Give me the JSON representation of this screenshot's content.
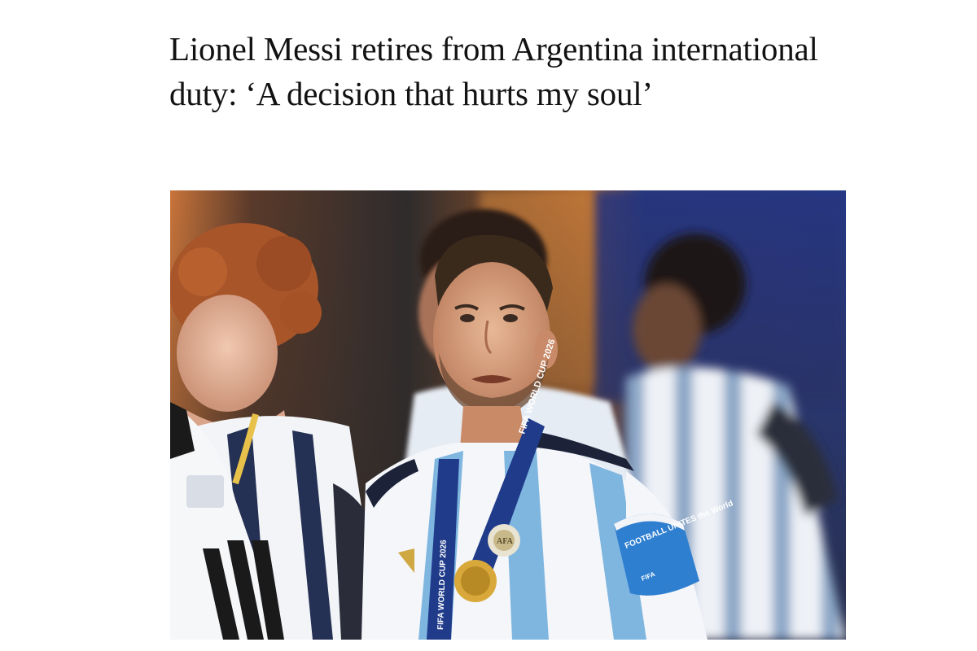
{
  "article": {
    "headline": "Lionel Messi retires from Argentina international duty: ‘A decision that hurts my soul’"
  },
  "photo": {
    "medal_ribbon_text": "FIFA WORLD CUP 2026",
    "badge_text": "AFA",
    "armband_text": "FOOTBALL UNITES the World",
    "armband_brand": "FIFA"
  },
  "colors": {
    "headline_text": "#121212",
    "background": "#ffffff",
    "jersey_blue": "#7fb6e0",
    "armband_blue": "#2f7fd0"
  }
}
